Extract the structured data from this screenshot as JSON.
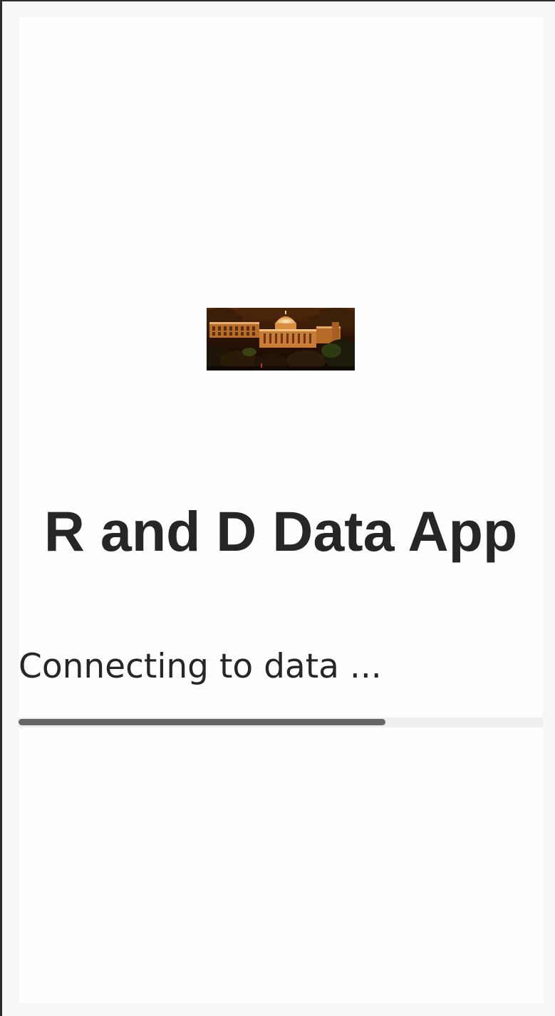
{
  "app": {
    "title": "R and D Data App"
  },
  "loading": {
    "status_text": "Connecting to data ...",
    "progress_fraction": 0.7
  },
  "logo": {
    "description_icon": "campus-building-photo"
  },
  "colors": {
    "text": "#262626",
    "progress_track": "#eeeeee",
    "progress_fill": "#666666"
  }
}
